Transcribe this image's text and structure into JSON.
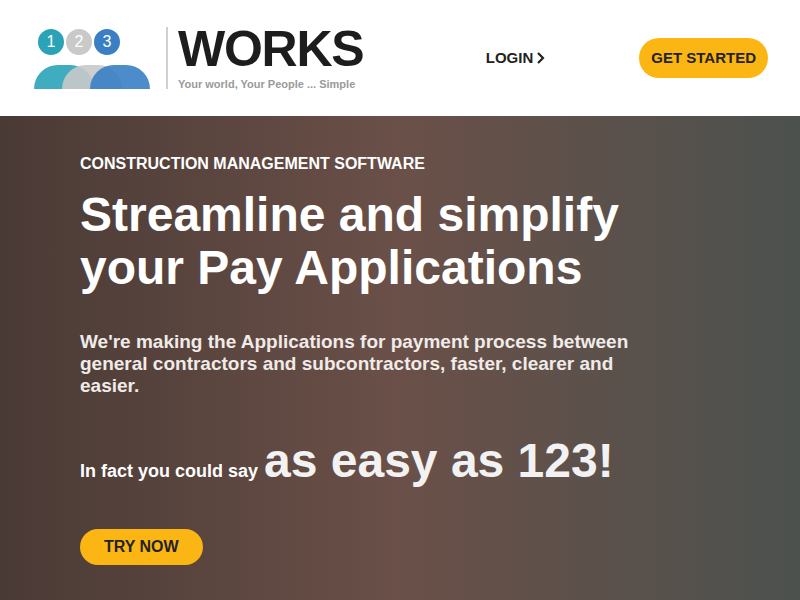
{
  "header": {
    "logo": {
      "numbers": [
        "1",
        "2",
        "3"
      ],
      "name": "WORKS",
      "tagline": "Your world, Your People ... Simple"
    },
    "nav": {
      "login": "LOGIN",
      "get_started": "GET STARTED"
    }
  },
  "hero": {
    "eyebrow": "CONSTRUCTION MANAGEMENT SOFTWARE",
    "title_lines": [
      "Streamline and simplify",
      "your Pay Applications"
    ],
    "subtitle": "We're making the Applications for payment process between general contractors and subcontractors, faster, clearer and easier.",
    "lead": "In fact you could say",
    "highlight": "as easy as 123!",
    "button": "TRY NOW"
  }
}
